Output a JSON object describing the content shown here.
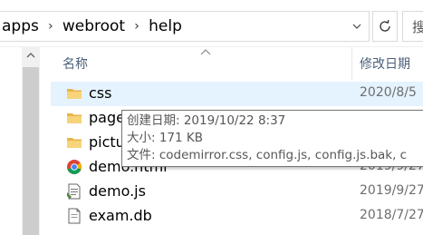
{
  "address_bar": {
    "crumbs": [
      "apps",
      "webroot",
      "help"
    ],
    "separator": "›"
  },
  "search": {
    "placeholder": "搜"
  },
  "columns": {
    "name": "名称",
    "date": "修改日期"
  },
  "files": [
    {
      "name": "css",
      "date": "2020/8/5",
      "icon": "folder-icon",
      "selected": true
    },
    {
      "name": "page",
      "date": "",
      "icon": "folder-icon"
    },
    {
      "name": "pictu",
      "date": "",
      "icon": "folder-icon"
    },
    {
      "name": "demo.html",
      "date": "2019/9/27",
      "icon": "chrome-icon"
    },
    {
      "name": "demo.js",
      "date": "2019/9/27",
      "icon": "js-file-icon"
    },
    {
      "name": "exam.db",
      "date": "2018/7/27",
      "icon": "file-icon"
    }
  ],
  "tooltip": {
    "created": "创建日期: 2019/10/22 8:37",
    "size": "大小: 171 KB",
    "files": "文件: codemirror.css, config.js, config.js.bak, c"
  },
  "colors": {
    "selection": "#e5f3ff",
    "folder": "#e8b448",
    "header_text": "#4c607a"
  }
}
